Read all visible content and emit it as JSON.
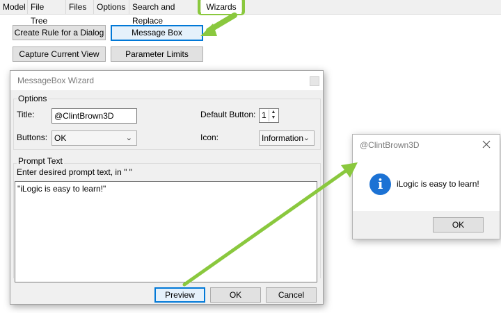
{
  "tabs": [
    {
      "label": "Model"
    },
    {
      "label": "File Tree"
    },
    {
      "label": "Files"
    },
    {
      "label": "Options"
    },
    {
      "label": "Search and Replace"
    },
    {
      "label": "Wizards"
    }
  ],
  "wizard_buttons": {
    "create_rule": "Create Rule for a Dialog",
    "message_box": "Message Box",
    "capture_view": "Capture Current View",
    "parameter_limits": "Parameter Limits"
  },
  "dialog": {
    "title": "MessageBox Wizard",
    "options_label": "Options",
    "title_label": "Title:",
    "title_value": "@ClintBrown3D",
    "default_button_label": "Default Button:",
    "default_button_value": "1",
    "buttons_label": "Buttons:",
    "buttons_value": "OK",
    "icon_label": "Icon:",
    "icon_value": "Information",
    "prompt_group_label": "Prompt Text",
    "prompt_instruction": "Enter desired prompt text, in \" \"",
    "prompt_value": "\"iLogic is easy to learn!\"",
    "preview_label": "Preview",
    "ok_label": "OK",
    "cancel_label": "Cancel"
  },
  "message_box": {
    "title": "@ClintBrown3D",
    "message": "iLogic is easy to learn!",
    "ok_label": "OK",
    "icon_glyph": "i"
  },
  "colors": {
    "highlight_green": "#8ac83e",
    "focus_blue": "#0078d7",
    "info_blue": "#1c72d4"
  }
}
